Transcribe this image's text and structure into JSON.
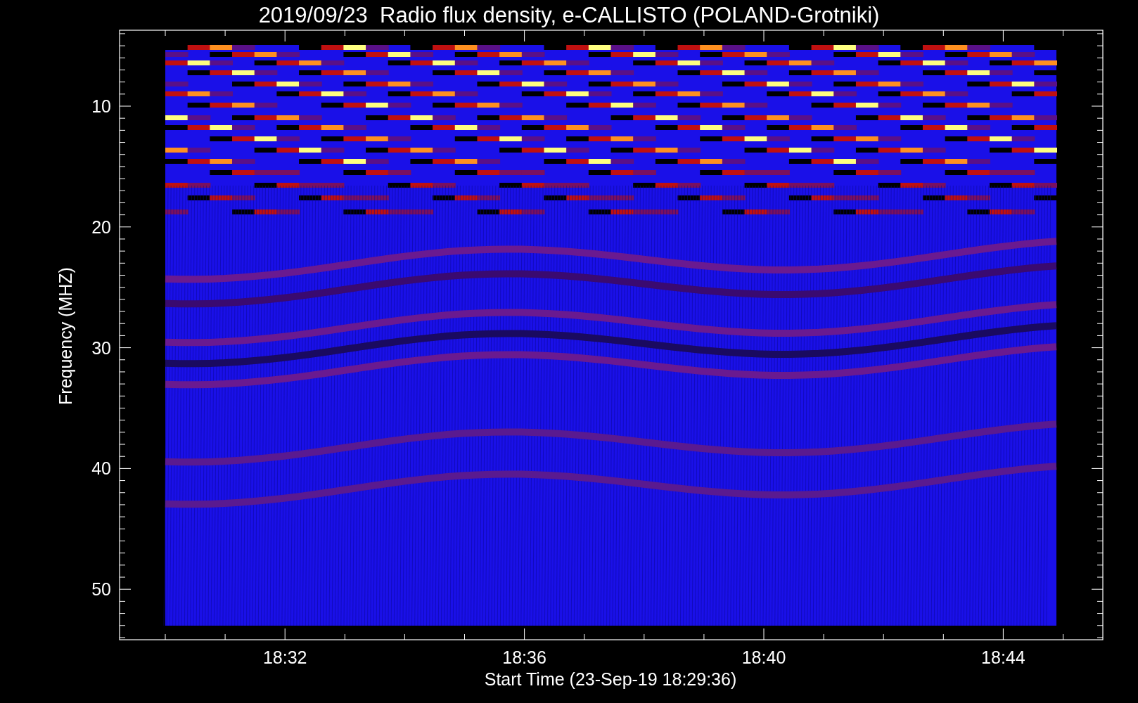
{
  "title": "2019/09/23  Radio flux density, e-CALLISTO (POLAND-Grotniki)",
  "plot": {
    "ylabel": "Frequency (MHZ)",
    "xlabel": "Start Time (23-Sep-19 18:29:36)",
    "yticks": [
      "10",
      "20",
      "30",
      "40",
      "50"
    ],
    "xticks": [
      "18:32",
      "18:36",
      "18:40",
      "18:44"
    ]
  }
}
